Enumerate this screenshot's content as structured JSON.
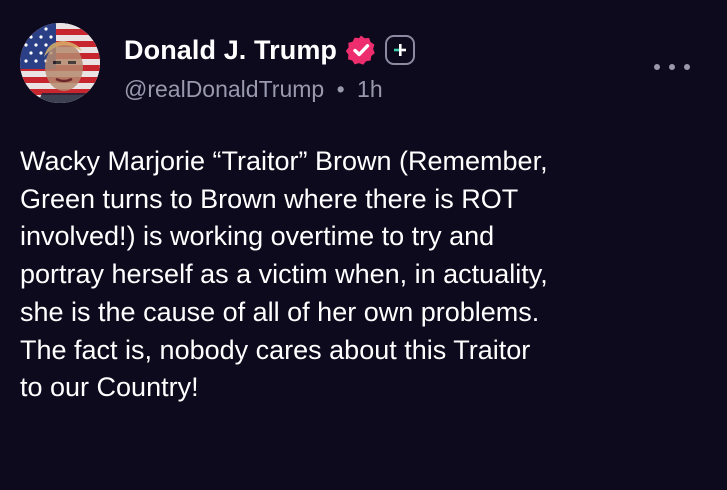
{
  "post": {
    "author": {
      "display_name": "Donald J. Trump",
      "handle": "@realDonaldTrump",
      "separator": "•",
      "time_ago": "1h",
      "avatar_icon": "avatar-flag-portrait",
      "verified_icon": "verified-badge-icon",
      "verified_color": "#ee2d6e",
      "plus_icon": "plus-badge-icon"
    },
    "more_icon": "more-options-icon",
    "text": "Wacky Marjorie “Traitor” Brown (Remember,\nGreen turns to Brown where there is ROT\ninvolved!) is working overtime to try and\nportray herself as a victim when, in actuality,\nshe is the cause of all of her own problems.\nThe fact is, nobody cares about this Traitor\nto our Country!"
  },
  "colors": {
    "background": "#0c0a1c",
    "text_primary": "#ffffff",
    "text_secondary": "#9a98ad",
    "accent_plus": "#3fd0b0"
  }
}
